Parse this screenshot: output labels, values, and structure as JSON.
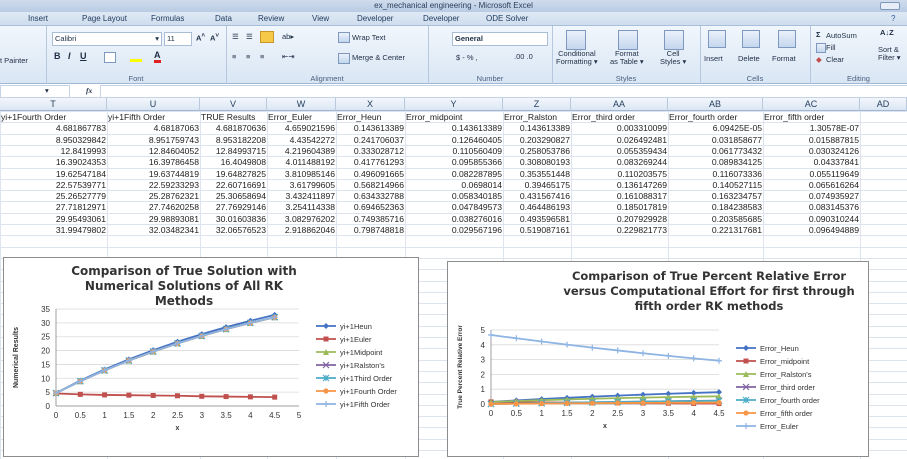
{
  "window": {
    "title": "ex_mechanical engineering - Microsoft Excel"
  },
  "tabs": [
    "Insert",
    "Page Layout",
    "Formulas",
    "Data",
    "Review",
    "View",
    "Developer",
    "Developer",
    "ODE Solver"
  ],
  "ribbon": {
    "clipboard": {
      "painter": "t Painter"
    },
    "font": {
      "name": "Calibri",
      "size": "11",
      "label": "Font"
    },
    "alignment": {
      "wrap": "Wrap Text",
      "merge": "Merge & Center",
      "label": "Alignment"
    },
    "number": {
      "format": "General",
      "symbols": "$ - % ,",
      "label": "Number"
    },
    "styles": {
      "conditional": "Conditional\nFormatting",
      "format_table": "Format\nas Table",
      "cell": "Cell\nStyles",
      "label": "Styles"
    },
    "cells": {
      "insert": "Insert",
      "delete": "Delete",
      "format": "Format",
      "label": "Cells"
    },
    "editing": {
      "autosum": "AutoSum",
      "fill": "Fill",
      "clear": "Clear",
      "sort": "Sort &\nFilter",
      "label": "Editing"
    }
  },
  "formula_bar": {
    "fx": "fx"
  },
  "columns": [
    "T",
    "U",
    "V",
    "W",
    "X",
    "Y",
    "Z",
    "AA",
    "AB",
    "AC",
    "AD"
  ],
  "table": {
    "headers": [
      "yi+1Fourth Order",
      "yi+1Fifth Order",
      "TRUE Results",
      "Error_Euler",
      "Error_Heun",
      "Error_midpoint",
      "Error_Ralston",
      "Error_third order",
      "Error_fourth order",
      "Error_fifth order"
    ],
    "rows": [
      [
        "4.681867783",
        "4.68187063",
        "4.681870636",
        "4.659021596",
        "0.143613389",
        "0.143613389",
        "0.143613389",
        "0.003310099",
        "6.09425E-05",
        "1.30578E-07"
      ],
      [
        "8.950329842",
        "8.951759743",
        "8.953182208",
        "4.43542272",
        "0.241706037",
        "0.126460405",
        "0.203290827",
        "0.026492481",
        "0.031858677",
        "0.015887815"
      ],
      [
        "12.8419993",
        "12.84604052",
        "12.84993715",
        "4.219604389",
        "0.333028712",
        "0.110560409",
        "0.258053786",
        "0.055359434",
        "0.061773432",
        "0.030324126"
      ],
      [
        "16.39024353",
        "16.39786458",
        "16.4049808",
        "4.011488192",
        "0.417761293",
        "0.095855366",
        "0.308080193",
        "0.083269244",
        "0.089834125",
        "0.04337841"
      ],
      [
        "19.62547184",
        "19.63744819",
        "19.64827825",
        "3.810985146",
        "0.496091665",
        "0.082287895",
        "0.353551448",
        "0.110203575",
        "0.116073336",
        "0.055119649"
      ],
      [
        "22.57539771",
        "22.59233293",
        "22.60716691",
        "3.61799605",
        "0.568214966",
        "0.0698014",
        "0.39465175",
        "0.136147269",
        "0.140527115",
        "0.065616264"
      ],
      [
        "25.26527779",
        "25.28762321",
        "25.30658694",
        "3.432411897",
        "0.634332788",
        "0.058340185",
        "0.431567416",
        "0.161088317",
        "0.163234757",
        "0.074935927"
      ],
      [
        "27.71812971",
        "27.74620258",
        "27.76929146",
        "3.254114338",
        "0.694652363",
        "0.047849573",
        "0.464486193",
        "0.185017819",
        "0.184238583",
        "0.083145376"
      ],
      [
        "29.95493061",
        "29.98893081",
        "30.01603836",
        "3.082976202",
        "0.749385716",
        "0.038276016",
        "0.493596581",
        "0.207929928",
        "0.203585685",
        "0.090310244"
      ],
      [
        "31.99479802",
        "32.03482341",
        "32.06576523",
        "2.918862046",
        "0.798748818",
        "0.029567196",
        "0.519087161",
        "0.229821773",
        "0.221317681",
        "0.096494889"
      ]
    ]
  },
  "chart_data": [
    {
      "type": "line",
      "title": "Comparison of True Solution with Numerical Solutions of All RK Methods",
      "xlabel": "x",
      "ylabel": "Numerical Results",
      "xlim": [
        0,
        5
      ],
      "ylim": [
        0,
        35
      ],
      "x_ticks": [
        "0",
        "0.5",
        "1",
        "1.5",
        "2",
        "2.5",
        "3",
        "3.5",
        "4",
        "4.5",
        "5"
      ],
      "y_ticks": [
        "0",
        "5",
        "10",
        "15",
        "20",
        "25",
        "30",
        "35"
      ],
      "x": [
        0,
        0.5,
        1,
        1.5,
        2,
        2.5,
        3,
        3.5,
        4,
        4.5
      ],
      "series": [
        {
          "name": "yi+1Heun",
          "color": "#4472c4",
          "marker": "diamond",
          "values": [
            4.68,
            9.19,
            13.18,
            16.82,
            20.14,
            23.18,
            25.94,
            28.46,
            30.77,
            32.86
          ]
        },
        {
          "name": "yi+1Euler",
          "color": "#c0504d",
          "marker": "square",
          "values": [
            4.5,
            4.2,
            4.0,
            3.9,
            3.8,
            3.7,
            3.5,
            3.4,
            3.3,
            3.2
          ]
        },
        {
          "name": "yi+1Midpoint",
          "color": "#9bbb59",
          "marker": "triangle",
          "values": [
            4.68,
            8.94,
            12.84,
            16.39,
            19.63,
            22.59,
            25.28,
            27.74,
            29.99,
            32.03
          ]
        },
        {
          "name": "yi+1Ralston's",
          "color": "#8064a2",
          "marker": "x",
          "values": [
            4.68,
            8.95,
            12.84,
            16.39,
            19.63,
            22.59,
            25.28,
            27.74,
            29.99,
            32.03
          ]
        },
        {
          "name": "yi+1Third Order",
          "color": "#4bacc6",
          "marker": "star",
          "values": [
            4.68,
            8.95,
            12.84,
            16.39,
            19.63,
            22.59,
            25.28,
            27.74,
            29.99,
            32.03
          ]
        },
        {
          "name": "yi+1Fourth Order",
          "color": "#f79646",
          "marker": "circle",
          "values": [
            4.68,
            8.95,
            12.84,
            16.39,
            19.63,
            22.58,
            25.27,
            27.72,
            29.95,
            31.99
          ]
        },
        {
          "name": "yi+1Fifth Order",
          "color": "#8eb4e3",
          "marker": "plus",
          "values": [
            4.68,
            8.95,
            12.85,
            16.4,
            19.64,
            22.59,
            25.29,
            27.75,
            29.99,
            32.03
          ]
        }
      ]
    },
    {
      "type": "line",
      "title": "Comparison of True Percent Relative Error versus Computational Effort for first through fifth order RK methods",
      "xlabel": "x",
      "ylabel": "True Percent Relative Error",
      "xlim": [
        0,
        4.5
      ],
      "ylim": [
        0,
        5
      ],
      "x_ticks": [
        "0",
        "0.5",
        "1",
        "1.5",
        "2",
        "2.5",
        "3",
        "3.5",
        "4",
        "4.5"
      ],
      "y_ticks": [
        "0",
        "1",
        "2",
        "3",
        "4",
        "5"
      ],
      "x": [
        0,
        0.5,
        1,
        1.5,
        2,
        2.5,
        3,
        3.5,
        4,
        4.5
      ],
      "series": [
        {
          "name": "Error_Heun",
          "color": "#4472c4",
          "marker": "diamond",
          "values": [
            0.144,
            0.242,
            0.333,
            0.418,
            0.496,
            0.568,
            0.634,
            0.695,
            0.749,
            0.799
          ]
        },
        {
          "name": "Error_midpoint",
          "color": "#c0504d",
          "marker": "square",
          "values": [
            0.144,
            0.126,
            0.111,
            0.096,
            0.082,
            0.07,
            0.058,
            0.048,
            0.038,
            0.03
          ]
        },
        {
          "name": "Error_Ralston's",
          "color": "#9bbb59",
          "marker": "triangle",
          "values": [
            0.144,
            0.203,
            0.258,
            0.308,
            0.354,
            0.395,
            0.432,
            0.464,
            0.494,
            0.519
          ]
        },
        {
          "name": "Error_third order",
          "color": "#8064a2",
          "marker": "x",
          "values": [
            0.003,
            0.026,
            0.055,
            0.083,
            0.11,
            0.136,
            0.161,
            0.185,
            0.208,
            0.23
          ]
        },
        {
          "name": "Error_fourth order",
          "color": "#4bacc6",
          "marker": "star",
          "values": [
            0.0001,
            0.032,
            0.062,
            0.09,
            0.116,
            0.141,
            0.163,
            0.184,
            0.204,
            0.221
          ]
        },
        {
          "name": "Error_fifth order",
          "color": "#f79646",
          "marker": "circle",
          "values": [
            0,
            0.016,
            0.03,
            0.043,
            0.055,
            0.066,
            0.075,
            0.083,
            0.09,
            0.096
          ]
        },
        {
          "name": "Error_Euler",
          "color": "#8eb4e3",
          "marker": "plus",
          "values": [
            4.66,
            4.44,
            4.22,
            4.01,
            3.81,
            3.62,
            3.43,
            3.25,
            3.08,
            2.92
          ]
        }
      ]
    }
  ]
}
